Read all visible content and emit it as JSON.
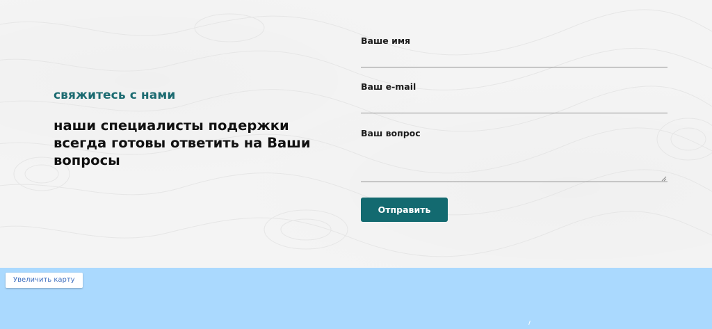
{
  "contact": {
    "subtitle": "свяжитесь с нами",
    "headline": "наши специалисты подержки всегда готовы ответить на Ваши вопросы"
  },
  "form": {
    "name_label": "Ваше имя",
    "name_value": "",
    "email_label": "Ваш e-mail",
    "email_value": "",
    "question_label": "Ваш вопрос",
    "question_value": "",
    "submit_label": "Отправить"
  },
  "map": {
    "enlarge_label": "Увеличить карту"
  },
  "colors": {
    "accent": "#136a70",
    "subtitle": "#1c6b71",
    "map_water": "#aad9fe",
    "link": "#3f6fbf"
  }
}
